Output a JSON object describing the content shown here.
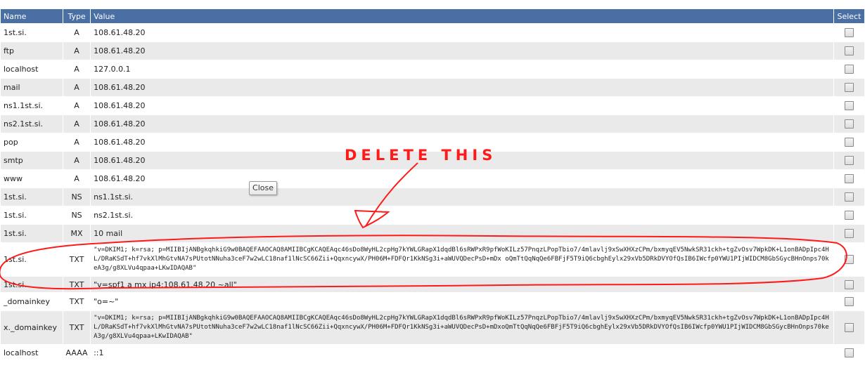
{
  "headers": {
    "name": "Name",
    "type": "Type",
    "value": "Value",
    "select": "Select"
  },
  "records": [
    {
      "name": "1st.si.",
      "type": "A",
      "value": "108.61.48.20"
    },
    {
      "name": "ftp",
      "type": "A",
      "value": "108.61.48.20"
    },
    {
      "name": "localhost",
      "type": "A",
      "value": "127.0.0.1"
    },
    {
      "name": "mail",
      "type": "A",
      "value": "108.61.48.20"
    },
    {
      "name": "ns1.1st.si.",
      "type": "A",
      "value": "108.61.48.20"
    },
    {
      "name": "ns2.1st.si.",
      "type": "A",
      "value": "108.61.48.20"
    },
    {
      "name": "pop",
      "type": "A",
      "value": "108.61.48.20"
    },
    {
      "name": "smtp",
      "type": "A",
      "value": "108.61.48.20"
    },
    {
      "name": "www",
      "type": "A",
      "value": "108.61.48.20"
    },
    {
      "name": "1st.si.",
      "type": "NS",
      "value": "ns1.1st.si."
    },
    {
      "name": "1st.si.",
      "type": "NS",
      "value": "ns2.1st.si."
    },
    {
      "name": "1st.si.",
      "type": "MX",
      "value": "10 mail"
    },
    {
      "name": "1st.si.",
      "type": "TXT",
      "value": "\"v=DKIM1; k=rsa; p=MIIBIjANBgkqhkiG9w0BAQEFAAOCAQ8AMIIBCgKCAQEAqc46sDo8WyHL2cpHg7kYWLGRapX1dqdBl6sRWPxR9pfWoKILz57PnqzLPopTbio7/4mlavlj9xSwXHXzCPm/bxmyqEV5NwkSR31ckh+tgZvOsv7WpkDK+L1onBADpIpc4HL/DRaKSdT+hf7vkXlMhGtvNA7sPUtotNNuha3ceF7w2wLC18naf1lNcSC66Zii+QqxncywX/PH06M+FDFQr1KkNSg3i+aWUVQDecPsD+mDx oQmTtQqNqQe6FBFjF5T9iQ6cbghEylx29xVb5DRkDVYOfQsIB6IWcfp0YWU1PIjWIDCM8GbSGycBHnOnps70keA3g/g8XLVu4qpaa+LKwIDAQAB\""
    },
    {
      "name": "1st.si.",
      "type": "TXT",
      "value": "\"v=spf1 a mx ip4:108.61.48.20 ~all\""
    },
    {
      "name": "_domainkey",
      "type": "TXT",
      "value": "\"o=~\""
    },
    {
      "name": "x._domainkey",
      "type": "TXT",
      "value": "\"v=DKIM1; k=rsa; p=MIIBIjANBgkqhkiG9w0BAQEFAAOCAQ8AMIIBCgKCAQEAqc46sDo8WyHL2cpHg7kYWLGRapX1dqdBl6sRWPxR9pfWoKILz57PnqzLPopTbio7/4mlavlj9xSwXHXzCPm/bxmyqEV5NwkSR31ckh+tgZvOsv7WpkDK+L1onBADpIpc4HL/DRaKSdT+hf7vkXlMhGtvNA7sPUtotNNuha3ceF7w2wLC18naf1lNcSC66Zii+QqxncywX/PH06M+FDFQr1KkNSg3i+aWUVQDecPsD+mDxoQmTtQqNqQe6FBFjF5T9iQ6cbghEylx29xVb5DRkDVYOfQsIB6IWcfp0YWU1PIjWIDCM8GbSGycBHnOnps70keA3g/g8XLVu4qpaa+LKwIDAQAB\""
    },
    {
      "name": "localhost",
      "type": "AAAA",
      "value": "::1"
    }
  ],
  "tooltip": {
    "close_label": "Close"
  },
  "annotation": {
    "text": "DELETE THIS",
    "color": "#ff1a1a"
  },
  "colors": {
    "header_bg": "#4a6fa5",
    "row_alt": "#eaeaea"
  }
}
